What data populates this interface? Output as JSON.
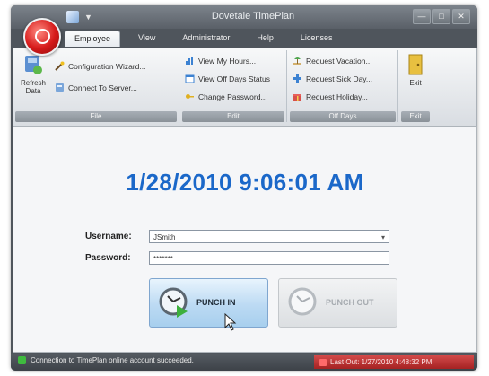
{
  "window": {
    "title": "Dovetale TimePlan",
    "controls": [
      "—",
      "□",
      "✕"
    ]
  },
  "tabs": [
    {
      "label": "Employee",
      "active": true
    },
    {
      "label": "View",
      "active": false
    },
    {
      "label": "Administrator",
      "active": false
    },
    {
      "label": "Help",
      "active": false
    },
    {
      "label": "Licenses",
      "active": false
    }
  ],
  "ribbon": {
    "file_group": {
      "refresh_label": "Refresh Data",
      "config_wizard": "Configuration Wizard...",
      "connect_server": "Connect To Server...",
      "label": "File"
    },
    "edit_group": {
      "view_hours": "View My Hours...",
      "view_offdays": "View Off Days Status",
      "change_password": "Change Password...",
      "label": "Edit"
    },
    "offdays_group": {
      "request_vacation": "Request Vacation...",
      "request_sickday": "Request Sick Day...",
      "request_holiday": "Request Holiday...",
      "label": "Off Days"
    },
    "exit_group": {
      "exit_label": "Exit",
      "label": "Exit"
    }
  },
  "main": {
    "datetime": "1/28/2010 9:06:01 AM",
    "username_label": "Username:",
    "username_value": "JSmith",
    "password_label": "Password:",
    "password_value": "*******",
    "punch_in_label": "PUNCH IN",
    "punch_out_label": "PUNCH OUT"
  },
  "status": {
    "left": "Connection to TimePlan online account succeeded.",
    "right": "Last Out: 1/27/2010 4:48:32 PM"
  },
  "colors": {
    "accent": "#1b68c9",
    "statusbar": "#3d4248",
    "alert": "#a62222"
  }
}
